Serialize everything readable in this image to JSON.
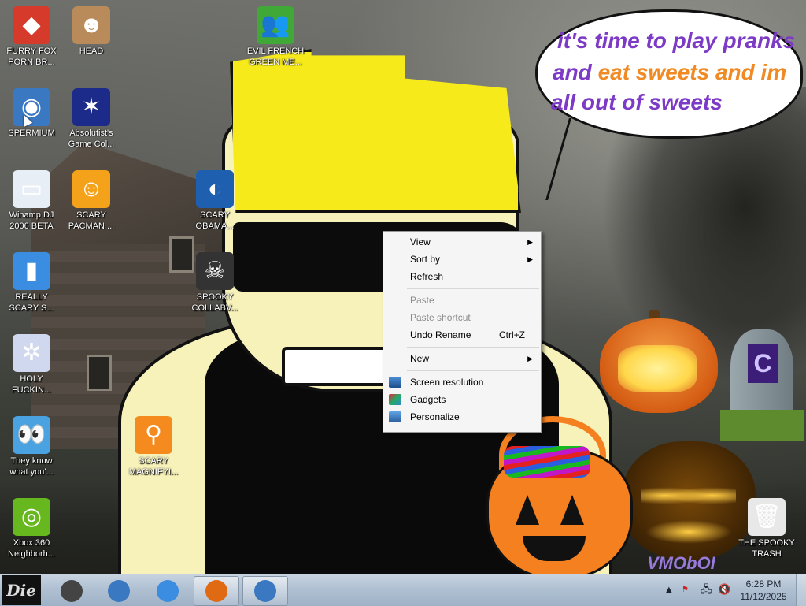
{
  "desktop": {
    "speech_bubble": {
      "line1": "it's time to play pranks",
      "line2_a": "and ",
      "line2_b": "eat sweets and im",
      "line3": "all out of sweets"
    },
    "watermark": "VMObOI",
    "tombstone_letter": "C",
    "icons": [
      {
        "label": "FURRY FOX\nPORN BR...",
        "icon": "fox-browser-icon",
        "color": "#d63a2a",
        "glyph": "◆"
      },
      {
        "label": "HEAD",
        "icon": "head-photo-icon",
        "color": "#b98a5a",
        "glyph": "☻"
      },
      {
        "label": "EVIL FRENCH\nGREEN ME...",
        "icon": "messenger-people-icon",
        "color": "#3fa836",
        "glyph": "👥"
      },
      {
        "label": "SPERMIUM",
        "icon": "chromium-icon",
        "color": "#3a78c2",
        "glyph": "◉"
      },
      {
        "label": "Absolutist's\nGame Col...",
        "icon": "game-collection-icon",
        "color": "#1c2a8a",
        "glyph": "✶"
      },
      {
        "label": "Winamp DJ\n2006 BETA",
        "icon": "winamp-window-icon",
        "color": "#e8eef5",
        "glyph": "▭"
      },
      {
        "label": "SCARY\nPACMAN ...",
        "icon": "pumpkin-pacman-icon",
        "color": "#f4a21a",
        "glyph": "☺"
      },
      {
        "label": "SCARY\nOBAMA...",
        "icon": "obama-logo-icon",
        "color": "#1e5fb0",
        "glyph": "◐"
      },
      {
        "label": "REALLY\nSCARY S...",
        "icon": "xat-chat-icon",
        "color": "#3a8de0",
        "glyph": "▮"
      },
      {
        "label": "SPOOKY\nCOLLABV...",
        "icon": "skull-icon",
        "color": "#333333",
        "glyph": "☠"
      },
      {
        "label": "HOLY\nFUCKIN...",
        "icon": "spider-icon",
        "color": "#d0d8ef",
        "glyph": "✲"
      },
      {
        "label": "They know\nwhat you'...",
        "icon": "eyes-icon",
        "color": "#4aa3e0",
        "glyph": "👀"
      },
      {
        "label": "SCARY\nMAGNIFYI...",
        "icon": "magnifier-icon",
        "color": "#f58a1f",
        "glyph": "⚲"
      },
      {
        "label": "Xbox 360\nNeighborh...",
        "icon": "xbox-icon",
        "color": "#67b81f",
        "glyph": "◎"
      },
      {
        "label": "THE SPOOKY\nTRASH",
        "icon": "recycle-bin-icon",
        "color": "#e8e8e8",
        "glyph": "🗑"
      }
    ]
  },
  "context_menu": {
    "items": [
      {
        "label": "View",
        "submenu": true
      },
      {
        "label": "Sort by",
        "submenu": true
      },
      {
        "label": "Refresh"
      },
      {
        "label": "Paste",
        "disabled": true
      },
      {
        "label": "Paste shortcut",
        "disabled": true
      },
      {
        "label": "Undo Rename",
        "shortcut": "Ctrl+Z"
      },
      {
        "label": "New",
        "submenu": true
      },
      {
        "label": "Screen resolution",
        "icon": "monitor-icon"
      },
      {
        "label": "Gadgets",
        "icon": "gadgets-icon"
      },
      {
        "label": "Personalize",
        "icon": "personalize-icon"
      }
    ]
  },
  "taskbar": {
    "start_label": "Die",
    "buttons": [
      {
        "name": "folder-taskbar-button",
        "icon": "folder-icon",
        "color": "#444444",
        "active": false
      },
      {
        "name": "chromium-taskbar-button",
        "icon": "chromium-icon",
        "color": "#3a78c2",
        "active": false
      },
      {
        "name": "bucket-taskbar-button",
        "icon": "bucket-icon",
        "color": "#3a8de0",
        "active": false
      },
      {
        "name": "pumpkin-taskbar-button",
        "icon": "pumpkin-icon",
        "color": "#e06a14",
        "active": true
      },
      {
        "name": "chromium2-taskbar-button",
        "icon": "chromium-icon",
        "color": "#3a78c2",
        "active": true
      }
    ],
    "tray": {
      "show_hidden": "▲",
      "clock_time": "6:28 PM",
      "clock_date": "11/12/2025"
    }
  }
}
